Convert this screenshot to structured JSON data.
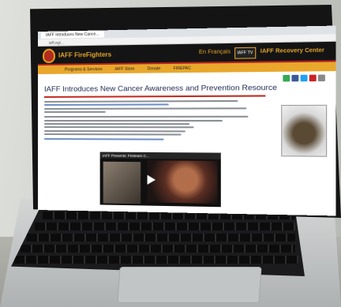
{
  "browser": {
    "tab_title": "IAFF Introduces New Cance...",
    "url": "iaff.org/...",
    "user": ""
  },
  "site": {
    "name": "IAFF FireFighters",
    "language_link": "En Français",
    "tv_label": "IAFF TV",
    "recovery_link": "IAFF Recovery Center",
    "nav": [
      "Programs & Services",
      "IAFF Store",
      "Donate",
      "FIREPAC"
    ]
  },
  "article": {
    "title": "IAFF Introduces New Cancer Awareness and Prevention Resource"
  },
  "video": {
    "title": "IAFF Presents: Fireteam C...",
    "caption": ""
  },
  "colors": {
    "header_bg": "#141414",
    "brand_gold": "#e3a42a",
    "accent_red": "#c22a20",
    "title_blue": "#1f2a55"
  },
  "icons": [
    "share-icon",
    "facebook-icon",
    "twitter-icon",
    "pinterest-icon",
    "email-icon"
  ]
}
